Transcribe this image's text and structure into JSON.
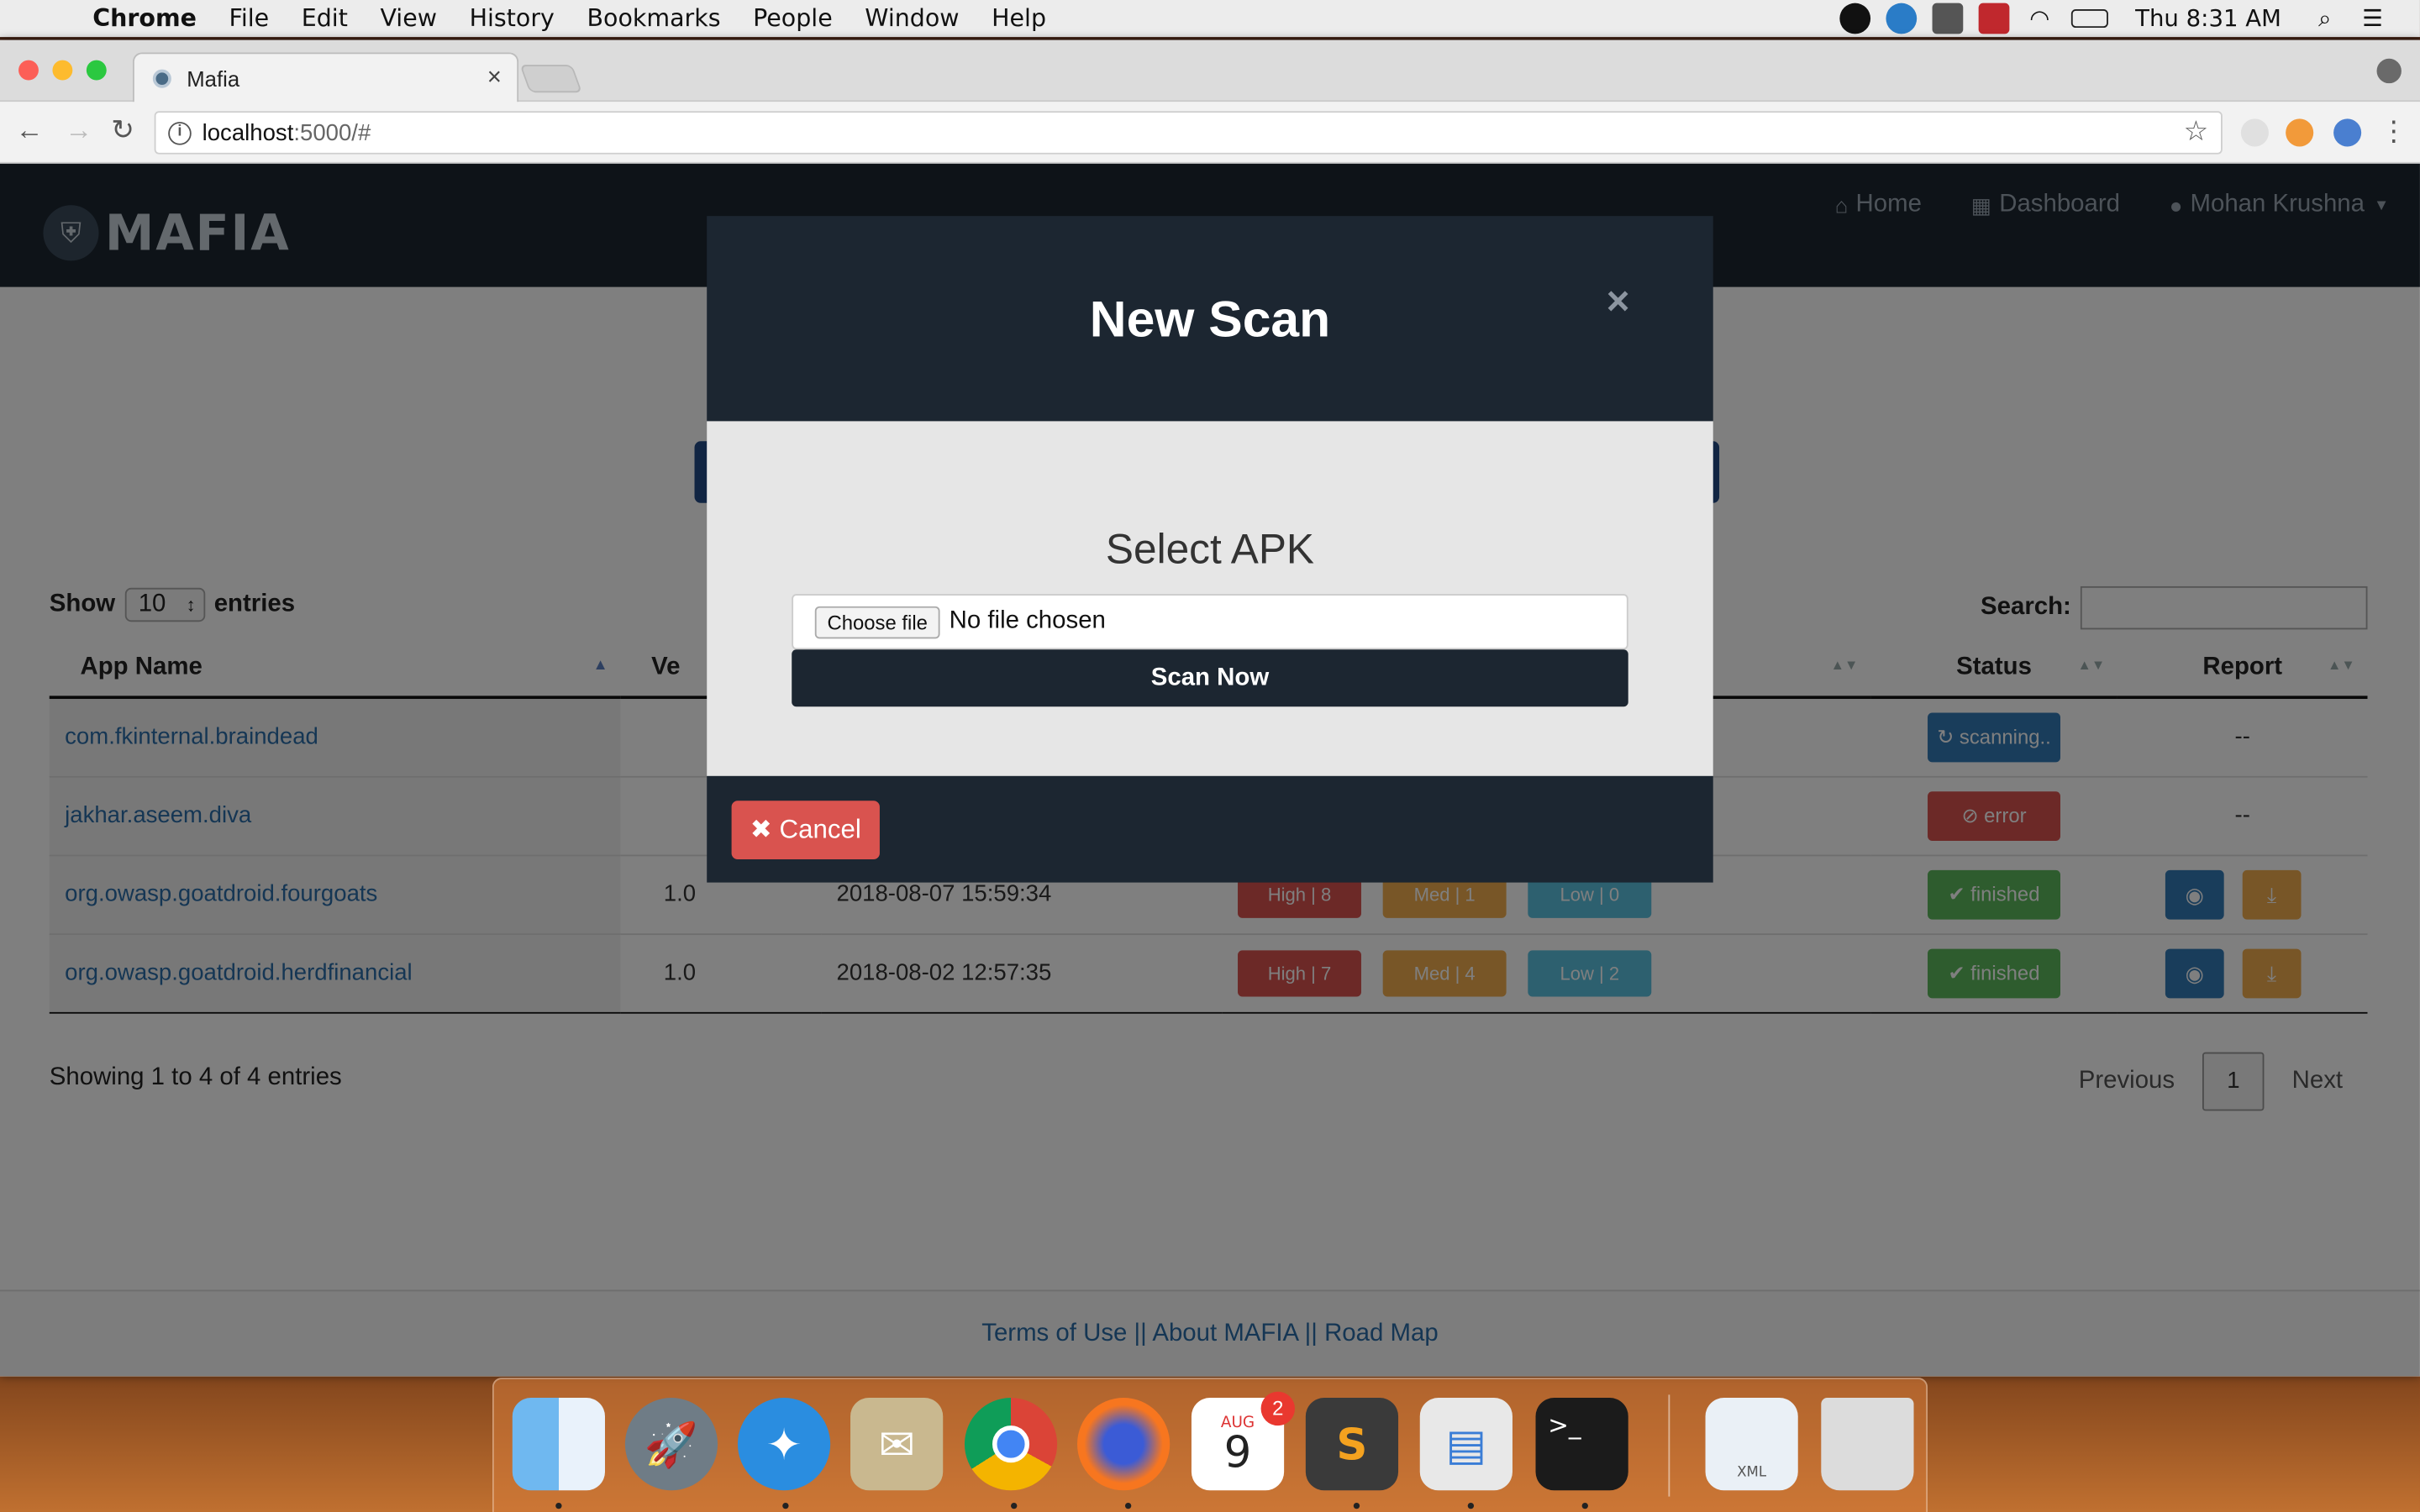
{
  "menubar": {
    "app": "Chrome",
    "items": [
      "File",
      "Edit",
      "View",
      "History",
      "Bookmarks",
      "People",
      "Window",
      "Help"
    ],
    "time": "Thu 8:31 AM"
  },
  "browser": {
    "tab_title": "Mafia",
    "url_host": "localhost",
    "url_path": ":5000/#"
  },
  "app": {
    "logo": "MAFIA",
    "nav": {
      "home": "Home",
      "dashboard": "Dashboard",
      "user": "Mohan Krushna"
    }
  },
  "table": {
    "show_label": "Show",
    "entries_value": "10",
    "entries_label": "entries",
    "search_label": "Search:",
    "columns": {
      "app": "App Name",
      "version": "Ve",
      "status": "Status",
      "report": "Report"
    },
    "rows": [
      {
        "app": "com.fkinternal.braindead",
        "version": "",
        "date": "",
        "high": "",
        "med": "",
        "low": "",
        "status": "scanning..",
        "report": "--"
      },
      {
        "app": "jakhar.aseem.diva",
        "version": "",
        "date": "",
        "high": "",
        "med": "",
        "low": "",
        "status": "error",
        "report": "--"
      },
      {
        "app": "org.owasp.goatdroid.fourgoats",
        "version": "1.0",
        "date": "2018-08-07 15:59:34",
        "high": "High | 8",
        "med": "Med | 1",
        "low": "Low | 0",
        "status": "finished",
        "report": ""
      },
      {
        "app": "org.owasp.goatdroid.herdfinancial",
        "version": "1.0",
        "date": "2018-08-02 12:57:35",
        "high": "High | 7",
        "med": "Med | 4",
        "low": "Low | 2",
        "status": "finished",
        "report": ""
      }
    ],
    "info": "Showing 1 to 4 of 4 entries",
    "pagination": {
      "previous": "Previous",
      "page": "1",
      "next": "Next"
    }
  },
  "footer": {
    "terms": "Terms of Use",
    "sep1": " || ",
    "about": "About MAFIA",
    "sep2": " || ",
    "roadmap": "Road Map"
  },
  "modal": {
    "title": "New Scan",
    "close": "×",
    "select_label": "Select APK",
    "choose_file": "Choose file",
    "no_file": "No file chosen",
    "scan_button": "Scan Now",
    "cancel_button": "✖ Cancel"
  },
  "dock": {
    "calendar_month": "AUG",
    "calendar_day": "9",
    "calendar_badge": "2",
    "xml_label": "XML"
  }
}
